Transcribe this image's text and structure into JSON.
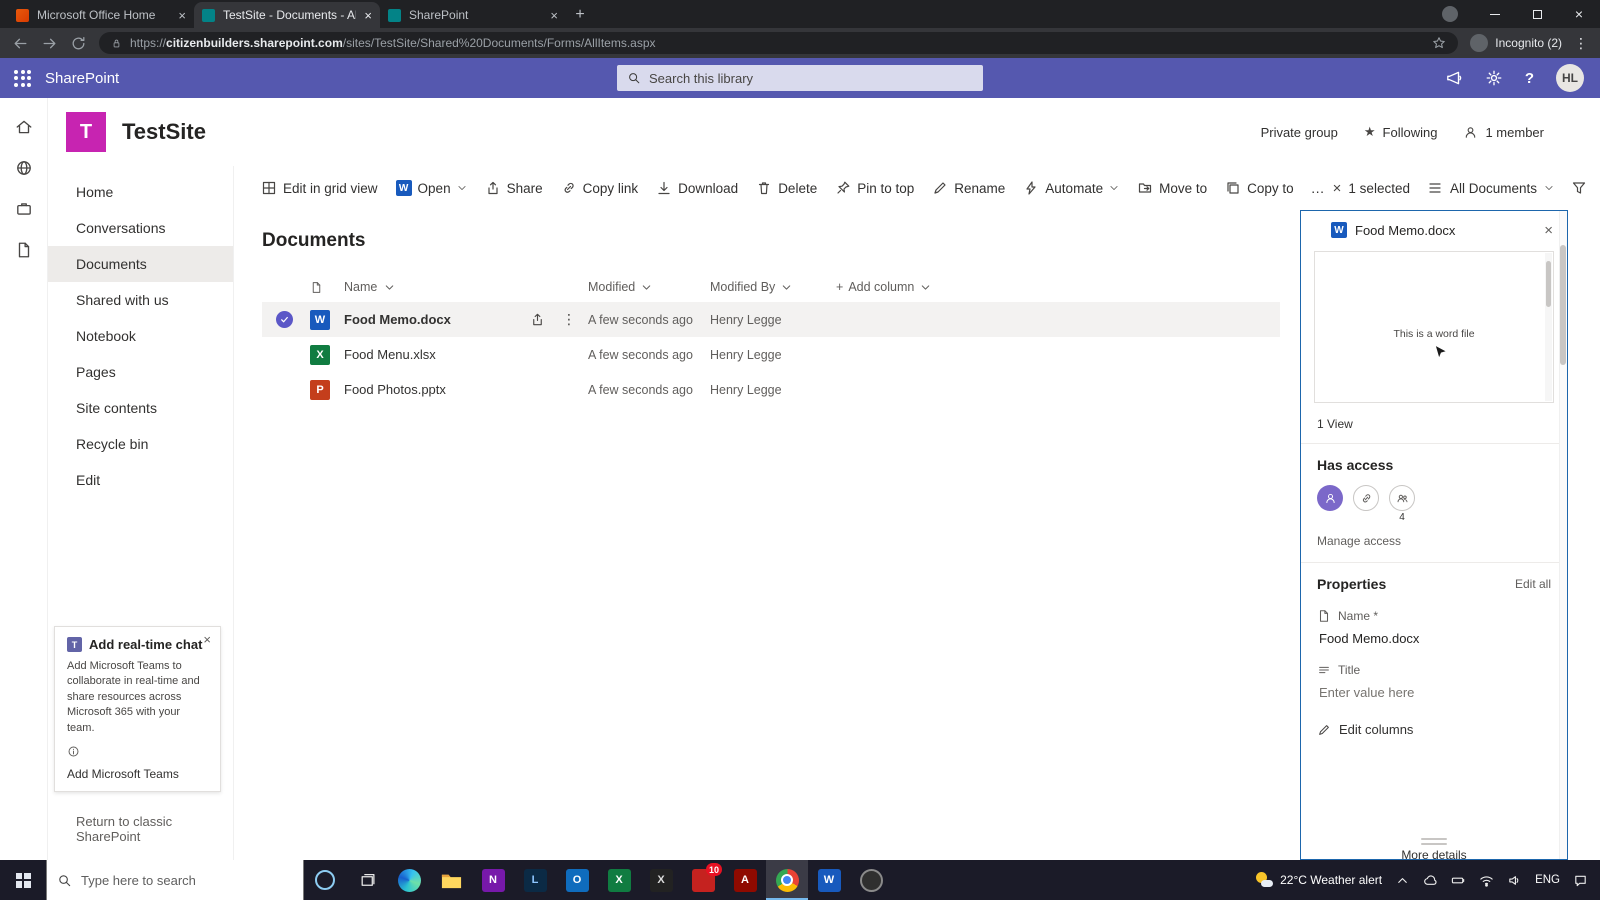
{
  "colors": {
    "suite_bar": "#5558AF",
    "accent": "#0078d4",
    "site_logo": "#C724B1",
    "word_brand": "#185ABD",
    "excel_brand": "#107C41",
    "powerpoint_brand": "#C43E1C",
    "selection_check": "#5B57C7",
    "panel_border": "#1d66ac"
  },
  "browser": {
    "tabs": [
      {
        "title": "Microsoft Office Home"
      },
      {
        "title": "TestSite - Documents - All Docu"
      },
      {
        "title": "SharePoint"
      }
    ],
    "url_scheme": "https://",
    "url_host": "citizenbuilders.sharepoint.com",
    "url_path": "/sites/TestSite/Shared%20Documents/Forms/AllItems.aspx",
    "incognito_label": "Incognito (2)"
  },
  "suite": {
    "app_name": "SharePoint",
    "search_placeholder": "Search this library",
    "help_label": "?",
    "avatar_initials": "HL"
  },
  "site": {
    "logo_letter": "T",
    "name": "TestSite",
    "privacy": "Private group",
    "following": "Following",
    "members": "1 member"
  },
  "sidebar": {
    "nav": [
      "Home",
      "Conversations",
      "Documents",
      "Shared with us",
      "Notebook",
      "Pages",
      "Site contents",
      "Recycle bin",
      "Edit"
    ],
    "card": {
      "title": "Add real-time chat",
      "body": "Add Microsoft Teams to collaborate in real-time and share resources across Microsoft 365 with your team.",
      "link": "Add Microsoft Teams"
    },
    "classic_link": "Return to classic SharePoint"
  },
  "command_bar": {
    "items": [
      "Edit in grid view",
      "Open",
      "Share",
      "Copy link",
      "Download",
      "Delete",
      "Pin to top",
      "Rename",
      "Automate",
      "Move to",
      "Copy to"
    ],
    "overflow": "…",
    "selected_label": "1 selected",
    "view_label": "All Documents"
  },
  "list": {
    "title": "Documents",
    "columns": [
      "Name",
      "Modified",
      "Modified By"
    ],
    "add_column_label": "Add column",
    "files": [
      {
        "name": "Food Memo.docx",
        "modified": "A few seconds ago",
        "modified_by": "Henry Legge"
      },
      {
        "name": "Food Menu.xlsx",
        "modified": "A few seconds ago",
        "modified_by": "Henry Legge"
      },
      {
        "name": "Food Photos.pptx",
        "modified": "A few seconds ago",
        "modified_by": "Henry Legge"
      }
    ]
  },
  "panel": {
    "title": "Food Memo.docx",
    "preview_text": "This is a word file",
    "views": "1 View",
    "has_access_title": "Has access",
    "access_extra_count": "4",
    "manage_access": "Manage access",
    "properties_title": "Properties",
    "edit_all": "Edit all",
    "name_label": "Name *",
    "name_value": "Food Memo.docx",
    "title_label": "Title",
    "title_placeholder": "Enter value here",
    "edit_columns": "Edit columns",
    "more_details": "More details"
  },
  "taskbar": {
    "search_placeholder": "Type here to search",
    "weather": "22°C Weather alert",
    "language": "ENG",
    "badge": "10"
  }
}
